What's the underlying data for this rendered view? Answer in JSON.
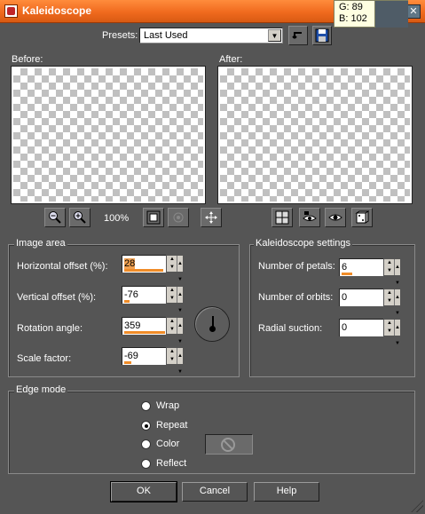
{
  "window": {
    "title": "Kaleidoscope",
    "close_glyph": "✕"
  },
  "tooltip": {
    "g_line": "G: 89",
    "b_line": "B: 102",
    "swatch_color": "#4f5c67"
  },
  "presets": {
    "label": "Presets:",
    "value": "Last Used"
  },
  "previews": {
    "before_label": "Before:",
    "after_label": "After:"
  },
  "zoom": {
    "value": "100%"
  },
  "image_area": {
    "title": "Image area",
    "horizontal_offset": {
      "label": "Horizontal offset (%):",
      "value": "28"
    },
    "vertical_offset": {
      "label": "Vertical offset (%):",
      "value": "-76"
    },
    "rotation_angle": {
      "label": "Rotation angle:",
      "value": "359"
    },
    "scale_factor": {
      "label": "Scale factor:",
      "value": "-69"
    }
  },
  "kaleidoscope_settings": {
    "title": "Kaleidoscope settings",
    "number_of_petals": {
      "label": "Number of petals:",
      "value": "6"
    },
    "number_of_orbits": {
      "label": "Number of orbits:",
      "value": "0"
    },
    "radial_suction": {
      "label": "Radial suction:",
      "value": "0"
    }
  },
  "edge_mode": {
    "title": "Edge mode",
    "options": [
      "Wrap",
      "Repeat",
      "Color",
      "Reflect"
    ],
    "selected": "Repeat"
  },
  "buttons": {
    "ok": "OK",
    "cancel": "Cancel",
    "help": "Help"
  }
}
